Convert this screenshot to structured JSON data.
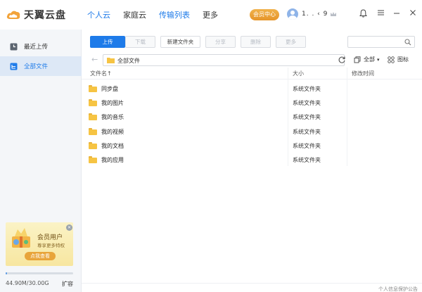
{
  "app": {
    "title": "天翼云盘"
  },
  "nav": {
    "tabs": [
      {
        "label": "个人云",
        "active": true
      },
      {
        "label": "家庭云",
        "active": false
      },
      {
        "label": "传输列表",
        "active": false
      },
      {
        "label": "更多",
        "active": false
      }
    ],
    "vip_label": "会员中心",
    "user_name": "1.  .    ‹ 9"
  },
  "sidebar": {
    "items": [
      {
        "label": "最近上传",
        "icon": "clock-icon",
        "selected": false
      },
      {
        "label": "全部文件",
        "icon": "folder-tree-icon",
        "selected": true
      }
    ],
    "promo": {
      "title": "会员用户",
      "subtitle": "尊享更多特权",
      "button": "点我查看"
    },
    "quota": {
      "text": "44.90M/30.00G",
      "used_fraction": 0.0015,
      "expand_label": "扩容"
    }
  },
  "toolbar": {
    "upload": "上传",
    "download": "下载",
    "new_folder": "新建文件夹",
    "share": "分享",
    "delete": "删除",
    "more": "更多",
    "search_placeholder": ""
  },
  "pathbar": {
    "path": "全部文件",
    "filter_label": "全部",
    "view_label": "图标"
  },
  "list": {
    "columns": {
      "name": "文件名↑",
      "size": "大小",
      "modified": "修改时间"
    },
    "rows": [
      {
        "name": "同步盘",
        "size": "系统文件夹",
        "modified": ""
      },
      {
        "name": "我的图片",
        "size": "系统文件夹",
        "modified": ""
      },
      {
        "name": "我的音乐",
        "size": "系统文件夹",
        "modified": ""
      },
      {
        "name": "我的视频",
        "size": "系统文件夹",
        "modified": ""
      },
      {
        "name": "我的文档",
        "size": "系统文件夹",
        "modified": ""
      },
      {
        "name": "我的应用",
        "size": "系统文件夹",
        "modified": ""
      }
    ]
  },
  "status": {
    "text": "个人信息保护公告"
  },
  "colors": {
    "accent": "#1e7be9",
    "vip": "#e6952a",
    "folder": "#f6c443"
  }
}
